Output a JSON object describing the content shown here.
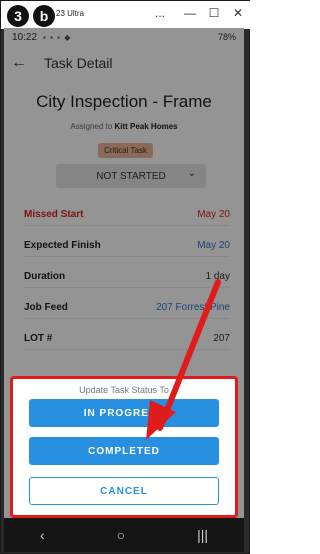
{
  "window": {
    "step_number": "3",
    "step_letter": "b",
    "title": "23 Ultra",
    "controls": [
      "...",
      "—",
      "☐",
      "✕"
    ]
  },
  "status_bar": {
    "time": "10:22",
    "battery": "78%"
  },
  "app_bar": {
    "title": "Task Detail"
  },
  "task": {
    "title": "City Inspection - Frame",
    "assigned_prefix": "Assigned to",
    "assigned_to": "Kitt Peak Homes",
    "badge": "Critical Task",
    "status": "NOT STARTED"
  },
  "details": [
    {
      "label": "Missed Start",
      "value": "May 20"
    },
    {
      "label": "Expected Finish",
      "value": "May 20"
    },
    {
      "label": "Duration",
      "value": "1 day"
    },
    {
      "label": "Job Feed",
      "value": "207 Forrest Pine"
    },
    {
      "label": "LOT #",
      "value": "207"
    }
  ],
  "sheet": {
    "title": "Update Task Status To",
    "in_progress": "IN PROGRESS",
    "completed": "COMPLETED",
    "cancel": "CANCEL"
  },
  "nav": {
    "back": "‹",
    "home": "○",
    "recents": "|||"
  },
  "colors": {
    "accent": "#2790e0",
    "annotation_red": "#e01b1b",
    "missed": "#dd2222",
    "badge_bg": "#e8b79a"
  }
}
